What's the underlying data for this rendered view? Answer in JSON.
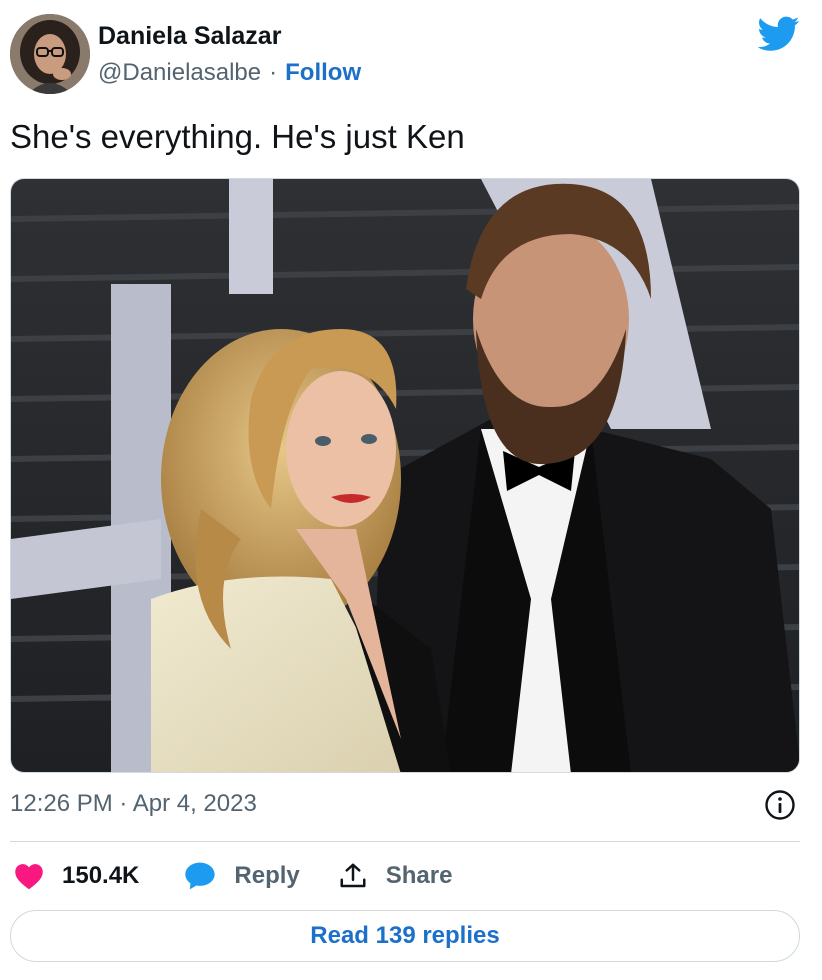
{
  "author": {
    "name": "Daniela Salazar",
    "handle": "@Danielasalbe",
    "separator": "·",
    "follow_label": "Follow"
  },
  "tweet": {
    "text": "She's everything. He's just Ken",
    "timestamp": "12:26 PM · Apr 4, 2023"
  },
  "actions": {
    "like_count": "150.4K",
    "reply_label": "Reply",
    "share_label": "Share"
  },
  "read_replies_label": "Read 139 replies",
  "icons": {
    "brand": "twitter-bird-icon",
    "like": "heart-icon",
    "reply": "speech-bubble-icon",
    "share": "share-upload-icon",
    "info": "info-icon"
  },
  "colors": {
    "twitter_blue": "#1d9bf0",
    "link_blue": "#1d70c9",
    "like_pink": "#f91880",
    "muted_text": "#536471"
  }
}
